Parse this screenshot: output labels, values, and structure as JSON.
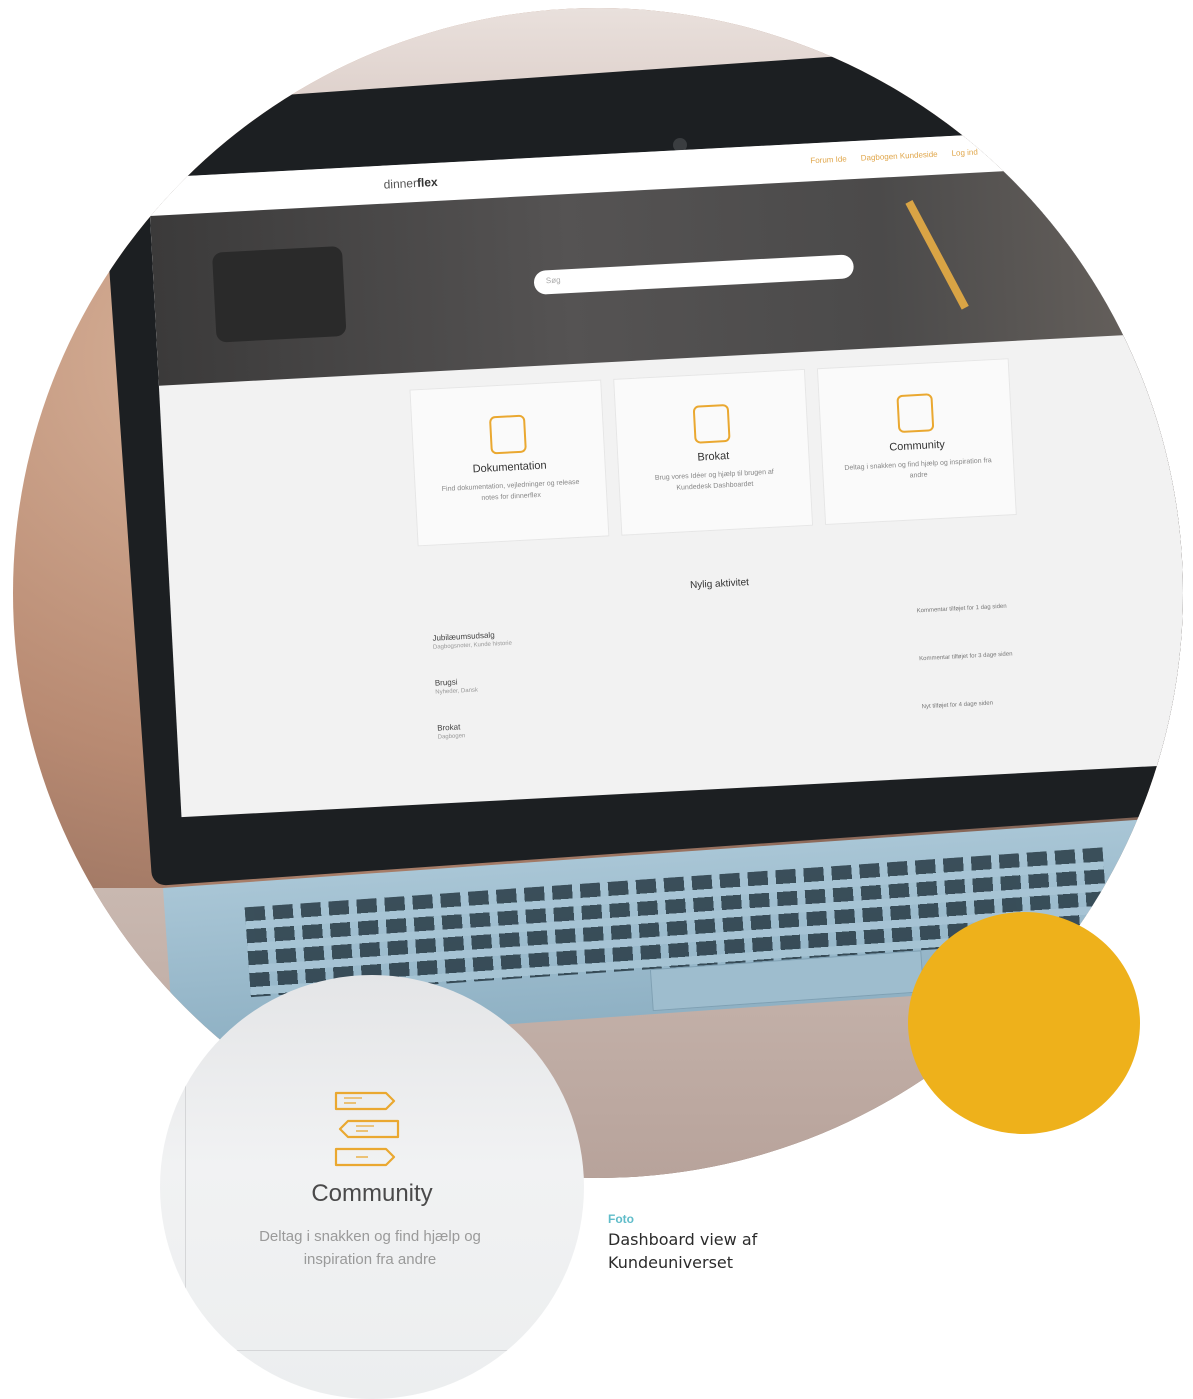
{
  "screen": {
    "logo_light": "dinner",
    "logo_bold": "flex",
    "nav": [
      "Forum Ide",
      "Dagbogen Kundeside",
      "Log ind"
    ],
    "search_placeholder": "Søg",
    "cards": [
      {
        "title": "Dokumentation",
        "desc": "Find dokumentation, vejledninger og release notes for dinnerflex"
      },
      {
        "title": "Brokat",
        "desc": "Brug vores Idéer og hjælp til brugen af Kundedesk Dashboardet"
      },
      {
        "title": "Community",
        "desc": "Deltag i snakken og find hjælp og inspiration fra andre"
      }
    ],
    "activity_title": "Nylig aktivitet",
    "activity_left": [
      {
        "title": "Jubilæumsudsalg",
        "sub": "Dagbogsnoter, Kunde historie"
      },
      {
        "title": "Brugsi",
        "sub": "Nyheder, Dansk"
      },
      {
        "title": "Brokat",
        "sub": "Dagbogen"
      }
    ],
    "activity_right": [
      "Kommentar tilføjet for 1 dag siden",
      "Kommentar tilføjet for 3 dage siden",
      "Nyt tilføjet for 4 dage siden"
    ]
  },
  "zoom": {
    "title": "Community",
    "desc": "Deltag i snakken og find hjælp og inspiration fra andre"
  },
  "caption": {
    "label": "Foto",
    "text": "Dashboard view af Kundeuniverset"
  },
  "colors": {
    "accent_yellow": "#eeb11b",
    "caption_label": "#5fbcc9",
    "icon_orange": "#eaa830"
  }
}
